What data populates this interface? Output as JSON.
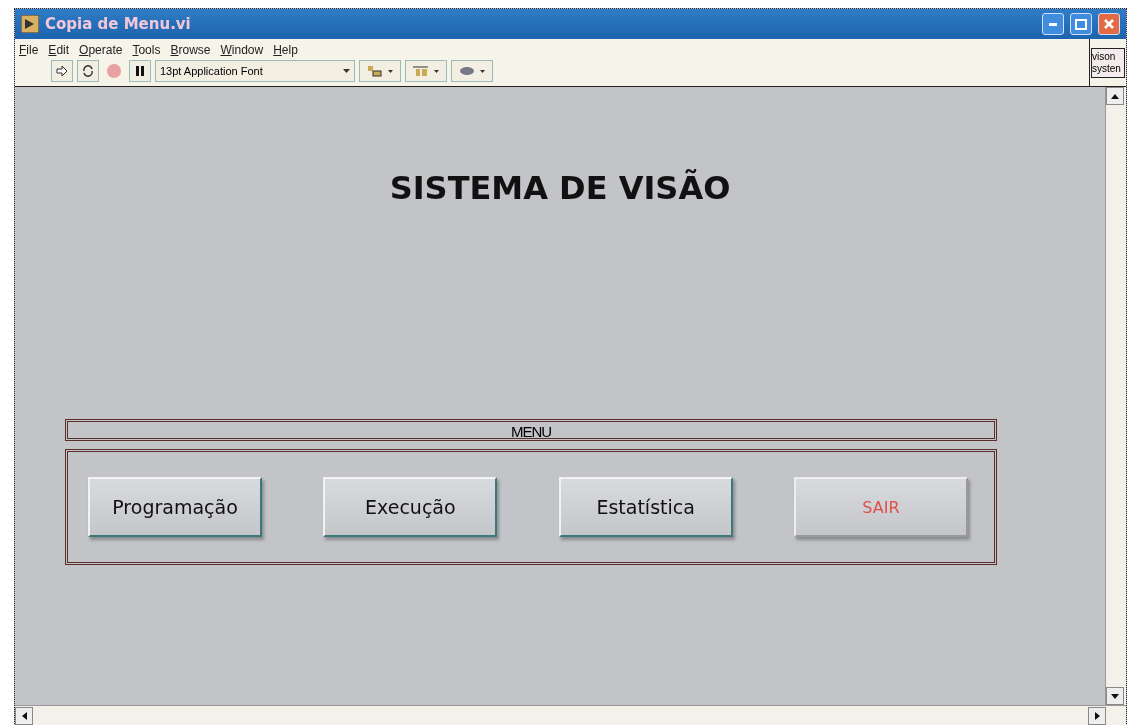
{
  "window": {
    "title": "Copia de Menu.vi"
  },
  "menu_bar": [
    {
      "label": "File",
      "underlined_initial": true
    },
    {
      "label": "Edit",
      "underlined_initial": true
    },
    {
      "label": "Operate",
      "underlined_initial": true
    },
    {
      "label": "Tools",
      "underlined_initial": true
    },
    {
      "label": "Browse",
      "underlined_initial": true
    },
    {
      "label": "Window",
      "underlined_initial": true
    },
    {
      "label": "Help",
      "underlined_initial": true
    }
  ],
  "toolbar": {
    "font_selector": "13pt Application Font",
    "vi_icon_text": [
      "vison",
      "systen"
    ]
  },
  "panel": {
    "heading": "SISTEMA DE VISÃO",
    "menu_label": "MENU",
    "buttons": [
      {
        "label": "Programação",
        "kind": "normal"
      },
      {
        "label": "Execução",
        "kind": "normal"
      },
      {
        "label": "Estatística",
        "kind": "normal"
      },
      {
        "label": "SAIR",
        "kind": "exit"
      }
    ]
  }
}
